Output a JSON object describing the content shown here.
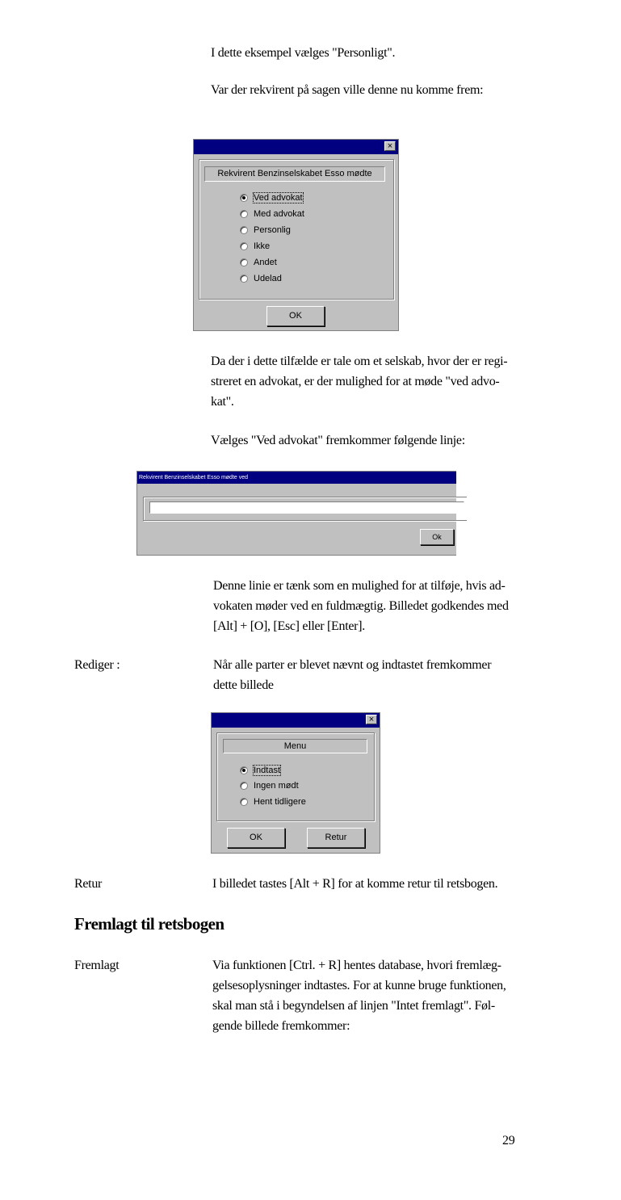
{
  "p1": "I dette eksempel vælges \"Personligt\".",
  "p2": "Var der rekvirent på sagen ville denne nu komme frem:",
  "dialog1": {
    "close": "×",
    "header": "Rekvirent Benzinselskabet Esso mødte",
    "options": [
      "Ved advokat",
      "Med advokat",
      "Personlig",
      "Ikke",
      "Andet",
      "Udelad"
    ],
    "ok": "OK"
  },
  "p3": [
    "Da der i dette tilfælde er tale om et selskab, hvor der er regi-",
    "streret en advokat, er der mulighed for at møde \"ved advo-",
    "kat\"."
  ],
  "p4": "Vælges \"Ved advokat\" fremkommer følgende linje:",
  "dialog2": {
    "title": "Rekvirent Benzinselskabet Esso mødte ved",
    "input_value": "",
    "ok": "Ok"
  },
  "p5": [
    "Denne linie er tænk som en mulighed for at tilføje, hvis ad-",
    "vokaten møder ved en fuldmægtig. Billedet godkendes med",
    "[Alt] + [O], [Esc] eller [Enter]."
  ],
  "label_rediger": "Rediger :",
  "p6": [
    "Når alle parter er blevet nævnt og indtastet fremkommer",
    "dette billede"
  ],
  "dialog3": {
    "close": "×",
    "header": "Menu",
    "options": [
      "Indtast",
      "Ingen mødt",
      "Hent tidligere"
    ],
    "ok": "OK",
    "retur": "Retur"
  },
  "label_retur": "Retur",
  "p7": "I billedet tastes [Alt + R] for at komme retur til retsbogen.",
  "heading": "Fremlagt til retsbogen",
  "label_fremlagt": "Fremlagt",
  "p8": [
    "Via funktionen [Ctrl. + R] hentes database, hvori fremlæg-",
    "gelsesoplysninger indtastes. For at kunne bruge funktionen,",
    "skal man stå i begyndelsen af linjen \"Intet fremlagt\". Føl-",
    "gende billede fremkommer:"
  ],
  "page_number": "29"
}
